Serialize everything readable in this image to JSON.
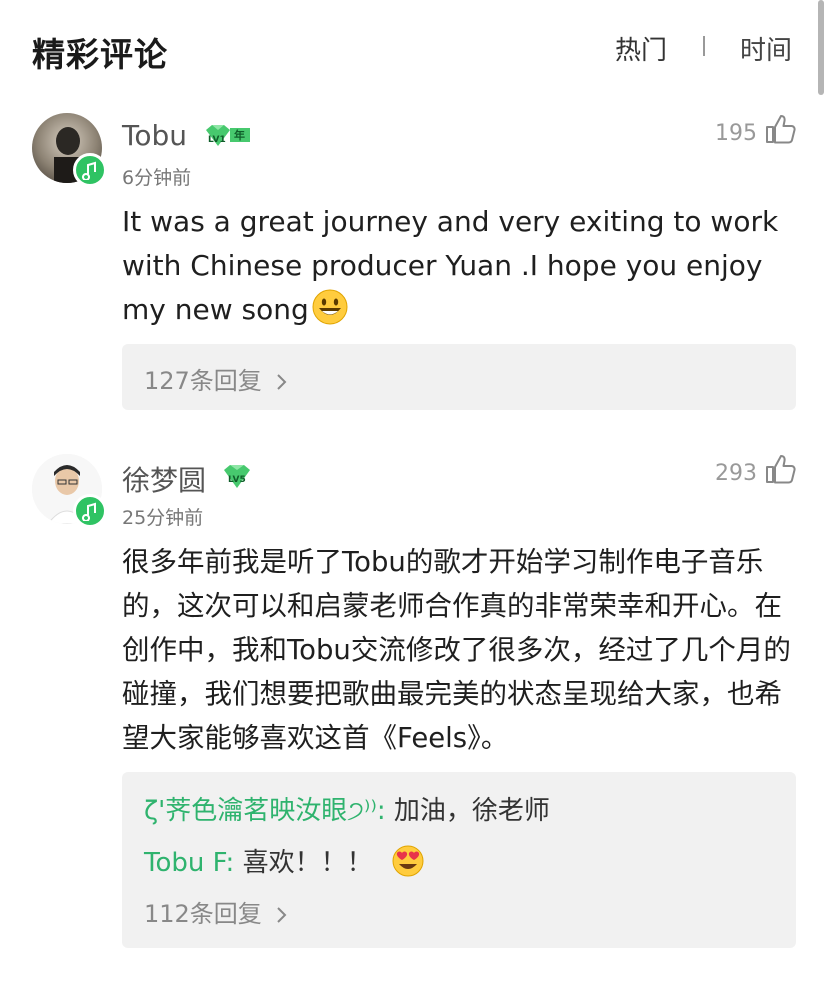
{
  "header": {
    "title": "精彩评论",
    "sort_hot": "热门",
    "sort_separator": "|",
    "sort_time": "时间"
  },
  "comments": [
    {
      "username": "Tobu",
      "level": "LV1",
      "badge_extra": "年",
      "time": "6分钟前",
      "likes": "195",
      "text": "It was a great journey and very exiting to work with Chinese producer Yuan .I hope you enjoy my new song",
      "reply_count": "127条回复"
    },
    {
      "username": "徐梦圆",
      "level": "LV5",
      "time": "25分钟前",
      "likes": "293",
      "text": "很多年前我是听了Tobu的歌才开始学习制作电子音乐的，这次可以和启蒙老师合作真的非常荣幸和开心。在创作中，我和Tobu交流修改了很多次，经过了几个月的碰撞，我们想要把歌曲最完美的状态呈现给大家，也希望大家能够喜欢这首《Feels》。",
      "replies": [
        {
          "name": "ζ'荠色瀹茗映汝眼੭⁾⁾:",
          "text": " 加油，徐老师"
        },
        {
          "name": "Tobu F:",
          "text": " 喜欢！！！"
        }
      ],
      "reply_count": "112条回复"
    }
  ],
  "colors": {
    "accent_green": "#2fc363",
    "reply_name": "#2fb36e",
    "reply_bg": "#f1f1f1"
  },
  "icons": [
    "thumbs-up-icon",
    "chevron-right-icon",
    "music-badge-icon",
    "level-diamond-icon",
    "smiley-emoji",
    "heart-eyes-emoji"
  ]
}
